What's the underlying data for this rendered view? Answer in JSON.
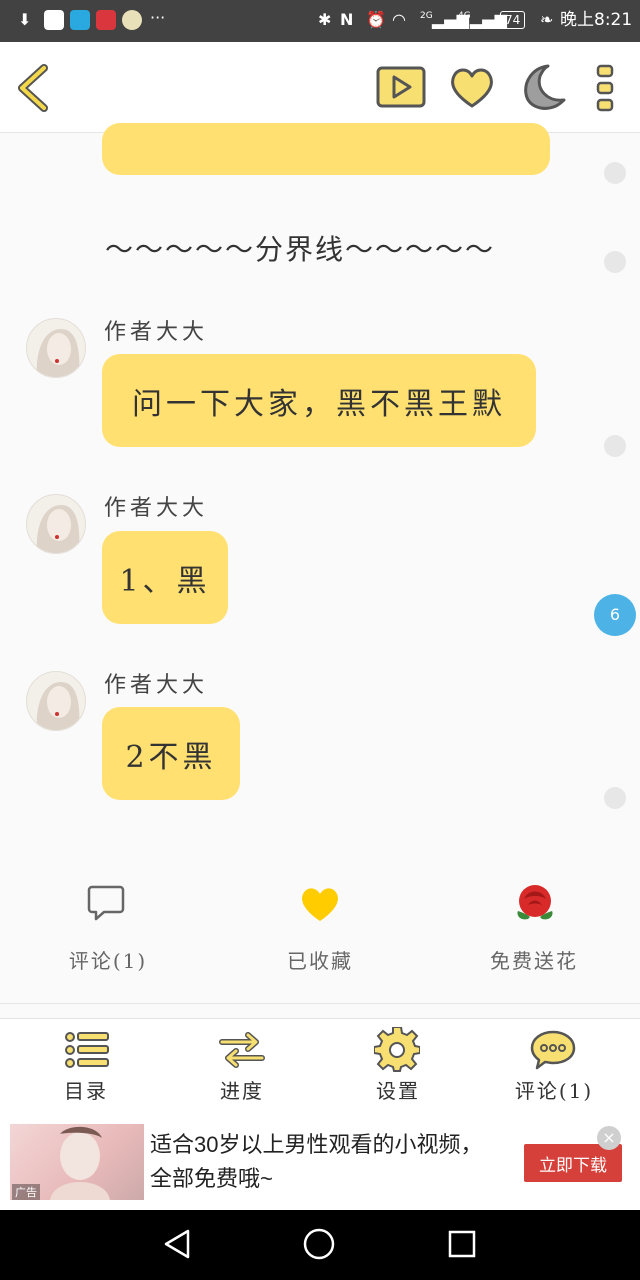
{
  "status_bar": {
    "time": "晚上8:21",
    "network_2g": "2G",
    "network_4g": "4G",
    "battery": "74",
    "more": "···"
  },
  "top_bar": {
    "back_icon": "back-chevron-icon",
    "video_icon": "play-icon",
    "favorite_icon": "heart-icon",
    "night_icon": "moon-icon",
    "menu_icon": "more-vertical-icon"
  },
  "chat": {
    "partial_bubble_text": "",
    "divider": "～～～～～分界线～～～～～",
    "messages": [
      {
        "author": "作者大大",
        "text": "问一下大家，黑不黑王默"
      },
      {
        "author": "作者大大",
        "text": "1、黑"
      },
      {
        "author": "作者大大",
        "text": "2不黑"
      }
    ],
    "comment_count_badge": "6"
  },
  "actions": {
    "comment": "评论(1)",
    "collected": "已收藏",
    "flower": "免费送花"
  },
  "bottom_nav": {
    "catalog": "目录",
    "progress": "进度",
    "settings": "设置",
    "comments": "评论(1)"
  },
  "ad": {
    "text": "适合30岁以上男性观看的小视频，全部免费哦~",
    "button": "立即下载",
    "tag": "广告",
    "close": "×"
  },
  "colors": {
    "accent_yellow": "#ffe071",
    "icon_yellow": "#f5d84a",
    "badge_blue": "#4db3e6",
    "ad_red": "#d6403b"
  }
}
